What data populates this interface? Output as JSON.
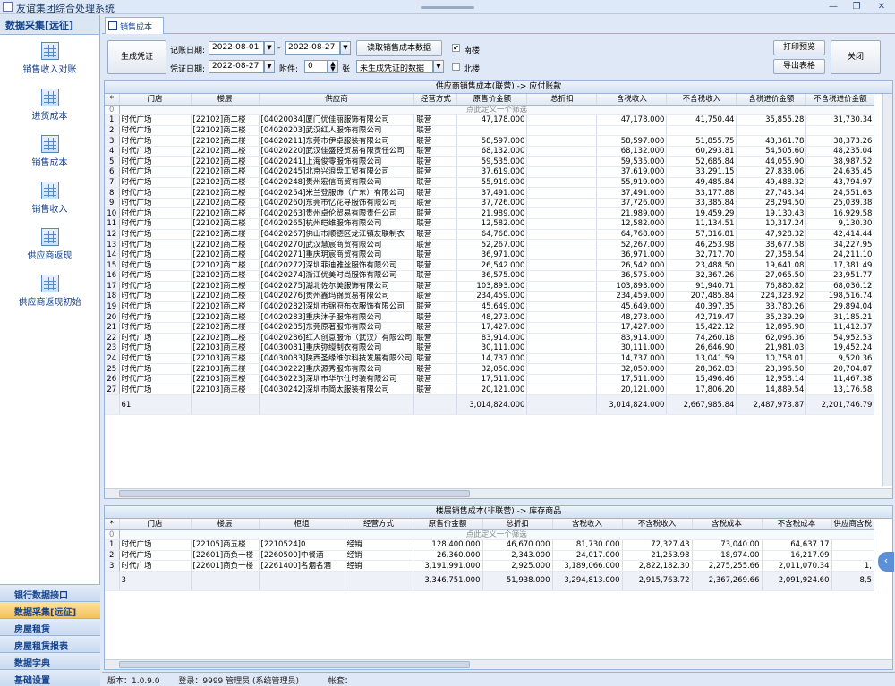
{
  "window": {
    "title": "友谊集团综合处理系统",
    "min": "—",
    "max": "❐",
    "close": "✕"
  },
  "sidebar": {
    "header": "数据采集[远征]",
    "items": [
      {
        "label": "销售收入对账"
      },
      {
        "label": "进货成本"
      },
      {
        "label": "销售成本"
      },
      {
        "label": "销售收入"
      },
      {
        "label": "供应商返现"
      },
      {
        "label": "供应商返现初始"
      }
    ],
    "categories": [
      {
        "label": "银行数据接口"
      },
      {
        "label": "数据采集[远征]"
      },
      {
        "label": "房屋租赁"
      },
      {
        "label": "房屋租赁报表"
      },
      {
        "label": "数据字典"
      },
      {
        "label": "基础设置"
      }
    ]
  },
  "tab": {
    "label": "销售成本"
  },
  "toolbar": {
    "gen_voucher": "生成凭证",
    "record_date_label": "记账日期:",
    "record_date_from": "2022-08-01",
    "dash": "-",
    "record_date_to": "2022-08-27",
    "voucher_date_label": "凭证日期:",
    "voucher_date": "2022-08-27",
    "attach_label": "附件:",
    "attach_value": "0",
    "attach_unit": "张",
    "read_btn": "读取销售成本数据",
    "status_select": "未生成凭证的数据",
    "south_label": "南楼",
    "south_checked": "✔",
    "north_label": "北楼",
    "print_btn": "打印预览",
    "export_btn": "导出表格",
    "close_btn": "关闭"
  },
  "grid1": {
    "title": "供应商销售成本(联营) -> 应付账款",
    "columns": [
      "*",
      "门店",
      "楼层",
      "供应商",
      "经营方式",
      "原售价金额",
      "总折扣",
      "含税收入",
      "不含税收入",
      "含税进价金额",
      "不含税进价金额"
    ],
    "filter": "点此定义一个筛选",
    "rows": [
      [
        "1",
        "时代广场",
        "[22102]商二楼",
        "[04020034]厦门优佳丽服饰有限公司",
        "联营",
        "47,178.000",
        "",
        "47,178.000",
        "41,750.44",
        "35,855.28",
        "31,730.34"
      ],
      [
        "2",
        "时代广场",
        "[22102]商二楼",
        "[04020203]武汉红人服饰有限公司",
        "联营",
        "",
        "",
        "",
        "",
        "",
        ""
      ],
      [
        "3",
        "时代广场",
        "[22102]商二楼",
        "[04020211]东莞市伊卓服装有限公司",
        "联营",
        "58,597.000",
        "",
        "58,597.000",
        "51,855.75",
        "43,361.78",
        "38,373.26"
      ],
      [
        "4",
        "时代广场",
        "[22102]商二楼",
        "[04020220]武汉佳盛轻贸易有限责任公司",
        "联营",
        "68,132.000",
        "",
        "68,132.000",
        "60,293.81",
        "54,505.60",
        "48,235.04"
      ],
      [
        "5",
        "时代广场",
        "[22102]商二楼",
        "[04020241]上海俊零服饰有限公司",
        "联营",
        "59,535.000",
        "",
        "59,535.000",
        "52,685.84",
        "44,055.90",
        "38,987.52"
      ],
      [
        "6",
        "时代广场",
        "[22102]商二楼",
        "[04020245]北京兴浪盘工贸有限公司",
        "联营",
        "37,619.000",
        "",
        "37,619.000",
        "33,291.15",
        "27,838.06",
        "24,635.45"
      ],
      [
        "7",
        "时代广场",
        "[22102]商二楼",
        "[04020248]贵州宏信商贸有限公司",
        "联营",
        "55,919.000",
        "",
        "55,919.000",
        "49,485.84",
        "49,488.32",
        "43,794.97"
      ],
      [
        "8",
        "时代广场",
        "[22102]商二楼",
        "[04020254]米兰登服饰（广东）有限公司",
        "联营",
        "37,491.000",
        "",
        "37,491.000",
        "33,177.88",
        "27,743.34",
        "24,551.63"
      ],
      [
        "9",
        "时代广场",
        "[22102]商二楼",
        "[04020260]东莞市忆花寻服饰有限公司",
        "联营",
        "37,726.000",
        "",
        "37,726.000",
        "33,385.84",
        "28,294.50",
        "25,039.38"
      ],
      [
        "10",
        "时代广场",
        "[22102]商二楼",
        "[04020263]贵州卓伦贸易有限责任公司",
        "联营",
        "21,989.000",
        "",
        "21,989.000",
        "19,459.29",
        "19,130.43",
        "16,929.58"
      ],
      [
        "11",
        "时代广场",
        "[22102]商二楼",
        "[04020265]杭州皑维服饰有限公司",
        "联营",
        "12,582.000",
        "",
        "12,582.000",
        "11,134.51",
        "10,317.24",
        "9,130.30"
      ],
      [
        "12",
        "时代广场",
        "[22102]商二楼",
        "[04020267]佛山市顺德区龙江镇友联制衣",
        "联营",
        "64,768.000",
        "",
        "64,768.000",
        "57,316.81",
        "47,928.32",
        "42,414.44"
      ],
      [
        "13",
        "时代广场",
        "[22102]商二楼",
        "[04020270]武汉慧宸商贸有限公司",
        "联营",
        "52,267.000",
        "",
        "52,267.000",
        "46,253.98",
        "38,677.58",
        "34,227.95"
      ],
      [
        "14",
        "时代广场",
        "[22102]商二楼",
        "[04020271]重庆玥宸商贸有限公司",
        "联营",
        "36,971.000",
        "",
        "36,971.000",
        "32,717.70",
        "27,358.54",
        "24,211.10"
      ],
      [
        "15",
        "时代广场",
        "[22102]商二楼",
        "[04020272]深圳菲迪雅丝服饰有限公司",
        "联营",
        "26,542.000",
        "",
        "26,542.000",
        "23,488.50",
        "19,641.08",
        "17,381.49"
      ],
      [
        "16",
        "时代广场",
        "[22102]商二楼",
        "[04020274]浙江优美时尚服饰有限公司",
        "联营",
        "36,575.000",
        "",
        "36,575.000",
        "32,367.26",
        "27,065.50",
        "23,951.77"
      ],
      [
        "17",
        "时代广场",
        "[22102]商二楼",
        "[04020275]湖北佐尔美服饰有限公司",
        "联营",
        "103,893.000",
        "",
        "103,893.000",
        "91,940.71",
        "76,880.82",
        "68,036.12"
      ],
      [
        "18",
        "时代广场",
        "[22102]商二楼",
        "[04020276]贵州鑫玛锦贸易有限公司",
        "联营",
        "234,459.000",
        "",
        "234,459.000",
        "207,485.84",
        "224,323.92",
        "198,516.74"
      ],
      [
        "19",
        "时代广场",
        "[22102]商二楼",
        "[04020282]深圳市锦府布衣服饰有限公司",
        "联营",
        "45,649.000",
        "",
        "45,649.000",
        "40,397.35",
        "33,780.26",
        "29,894.04"
      ],
      [
        "20",
        "时代广场",
        "[22102]商二楼",
        "[04020283]重庆沐子服饰有限公司",
        "联营",
        "48,273.000",
        "",
        "48,273.000",
        "42,719.47",
        "35,239.29",
        "31,185.21"
      ],
      [
        "21",
        "时代广场",
        "[22102]商二楼",
        "[04020285]东莞原著服饰有限公司",
        "联营",
        "17,427.000",
        "",
        "17,427.000",
        "15,422.12",
        "12,895.98",
        "11,412.37"
      ],
      [
        "22",
        "时代广场",
        "[22102]商二楼",
        "[04020286]红人创意服饰（武汉）有限公司",
        "联营",
        "83,914.000",
        "",
        "83,914.000",
        "74,260.18",
        "62,096.36",
        "54,952.53"
      ],
      [
        "23",
        "时代广场",
        "[22103]商三楼",
        "[04030081]重庆弥缦制衣有限公司",
        "联营",
        "30,111.000",
        "",
        "30,111.000",
        "26,646.90",
        "21,981.03",
        "19,452.24"
      ],
      [
        "24",
        "时代广场",
        "[22103]商三楼",
        "[04030083]陕西圣缘维尔科技发展有限公司",
        "联营",
        "14,737.000",
        "",
        "14,737.000",
        "13,041.59",
        "10,758.01",
        "9,520.36"
      ],
      [
        "25",
        "时代广场",
        "[22103]商三楼",
        "[04030222]重庆源秀服饰有限公司",
        "联营",
        "32,050.000",
        "",
        "32,050.000",
        "28,362.83",
        "23,396.50",
        "20,704.87"
      ],
      [
        "26",
        "时代广场",
        "[22103]商三楼",
        "[04030223]深圳市华尔仕时装有限公司",
        "联营",
        "17,511.000",
        "",
        "17,511.000",
        "15,496.46",
        "12,958.14",
        "11,467.38"
      ],
      [
        "27",
        "时代广场",
        "[22103]商三楼",
        "[04030242]深圳市简太服装有限公司",
        "联营",
        "20,121.000",
        "",
        "20,121.000",
        "17,806.20",
        "14,889.54",
        "13,176.58"
      ]
    ],
    "summary": [
      "",
      "61",
      "",
      "",
      "",
      "3,014,824.000",
      "",
      "3,014,824.000",
      "2,667,985.84",
      "2,487,973.87",
      "2,201,746.79"
    ]
  },
  "grid2": {
    "title": "楼层销售成本(非联营) -> 库存商品",
    "columns": [
      "*",
      "门店",
      "楼层",
      "柜组",
      "经营方式",
      "原售价金额",
      "总折扣",
      "含税收入",
      "不含税收入",
      "含税成本",
      "不含税成本",
      "供应商含税"
    ],
    "filter": "点此定义一个筛选",
    "rows": [
      [
        "1",
        "时代广场",
        "[22105]商五楼",
        "[2210524]0",
        "经销",
        "128,400.000",
        "46,670.000",
        "81,730.000",
        "72,327.43",
        "73,040.00",
        "64,637.17",
        ""
      ],
      [
        "2",
        "时代广场",
        "[22601]商负一楼",
        "[2260500]中餐酒",
        "经销",
        "26,360.000",
        "2,343.000",
        "24,017.000",
        "21,253.98",
        "18,974.00",
        "16,217.09",
        ""
      ],
      [
        "3",
        "时代广场",
        "[22601]商负一楼",
        "[2261400]名烟名酒",
        "经销",
        "3,191,991.000",
        "2,925.000",
        "3,189,066.000",
        "2,822,182.30",
        "2,275,255.66",
        "2,011,070.34",
        "1,"
      ]
    ],
    "summary": [
      "",
      "3",
      "",
      "",
      "",
      "3,346,751.000",
      "51,938.000",
      "3,294,813.000",
      "2,915,763.72",
      "2,367,269.66",
      "2,091,924.60",
      "8,5"
    ]
  },
  "status": {
    "version": "版本：1.0.9.0",
    "login": "登录：9999 管理员 (系统管理员)",
    "account": "帐套："
  }
}
